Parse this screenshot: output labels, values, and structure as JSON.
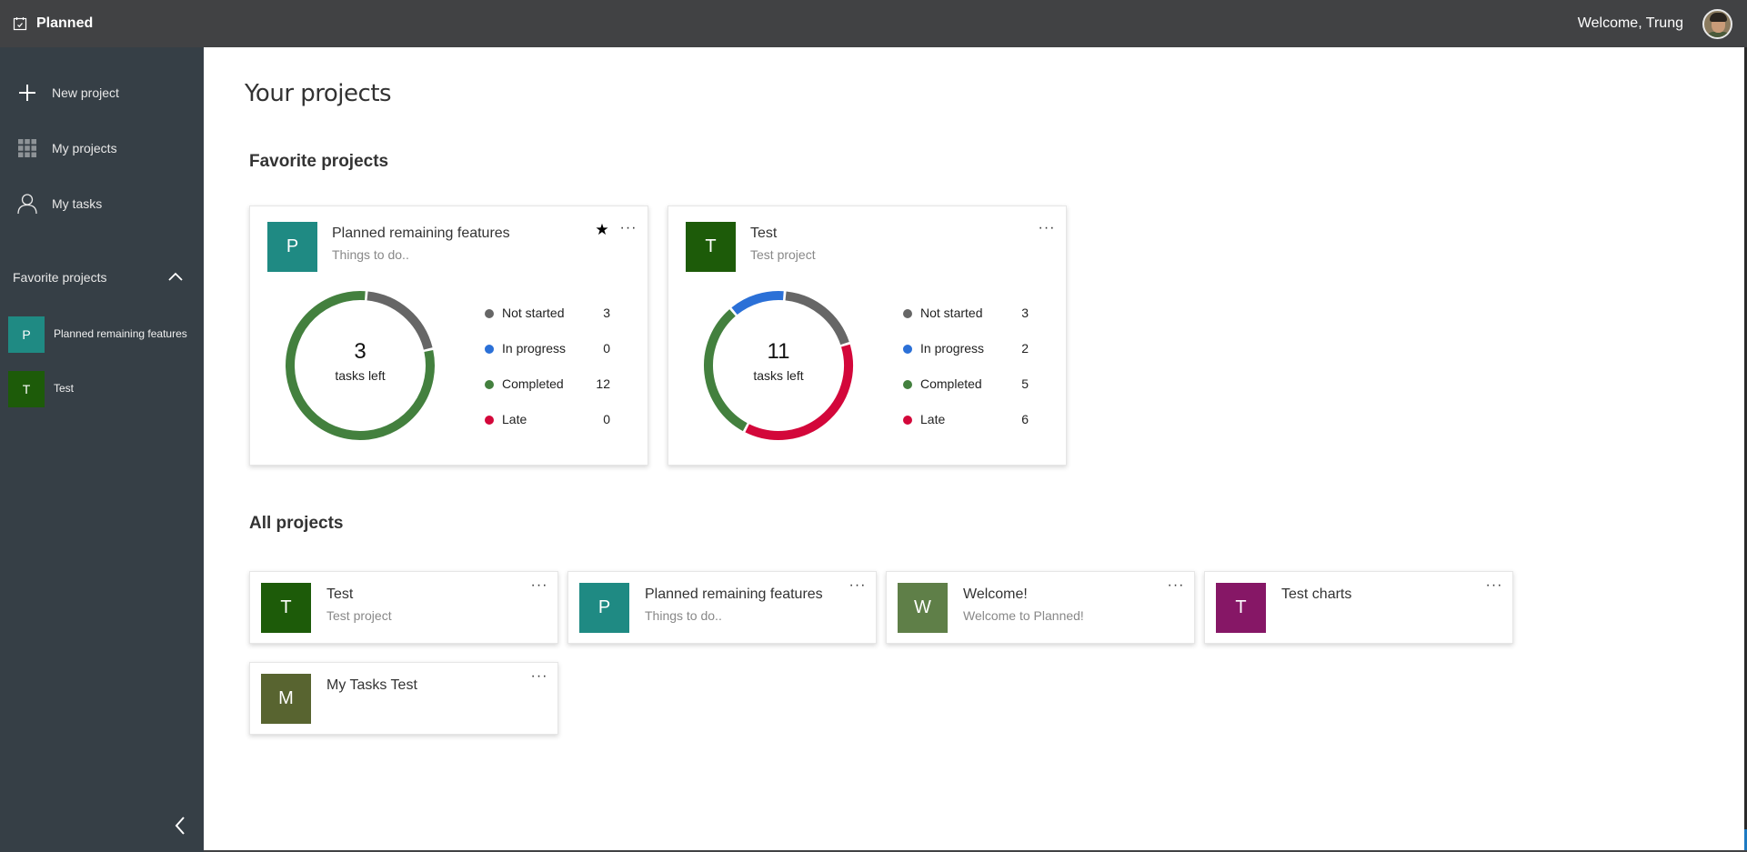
{
  "app": {
    "title": "Planned",
    "welcome": "Welcome, Trung"
  },
  "sidebar": {
    "nav": [
      {
        "label": "New project",
        "icon": "plus-icon"
      },
      {
        "label": "My projects",
        "icon": "grid-icon"
      },
      {
        "label": "My tasks",
        "icon": "person-icon"
      }
    ],
    "favorites_title": "Favorite projects",
    "favorites": [
      {
        "initial": "P",
        "label": "Planned remaining features",
        "color": "#1f8a83"
      },
      {
        "initial": "T",
        "label": "Test",
        "color": "#1d5b09"
      }
    ]
  },
  "main": {
    "page_title": "Your projects",
    "favorites_heading": "Favorite projects",
    "all_heading": "All projects",
    "status_colors": {
      "not_started": "#666666",
      "in_progress": "#2b70d7",
      "completed": "#43803e",
      "late": "#d3073a"
    },
    "favorite_cards": [
      {
        "initial": "P",
        "color": "#1f8a83",
        "title": "Planned remaining features",
        "subtitle": "Things to do..",
        "starred": true,
        "star": "★",
        "more": "···",
        "tasks_left": "3",
        "tasks_left_label": "tasks left",
        "legend": [
          {
            "key": "not_started",
            "label": "Not started",
            "value": 3
          },
          {
            "key": "in_progress",
            "label": "In progress",
            "value": 0
          },
          {
            "key": "completed",
            "label": "Completed",
            "value": 12
          },
          {
            "key": "late",
            "label": "Late",
            "value": 0
          }
        ]
      },
      {
        "initial": "T",
        "color": "#1d5b09",
        "title": "Test",
        "subtitle": "Test project",
        "starred": false,
        "star": "",
        "more": "···",
        "tasks_left": "11",
        "tasks_left_label": "tasks left",
        "legend": [
          {
            "key": "not_started",
            "label": "Not started",
            "value": 3
          },
          {
            "key": "in_progress",
            "label": "In progress",
            "value": 2
          },
          {
            "key": "completed",
            "label": "Completed",
            "value": 5
          },
          {
            "key": "late",
            "label": "Late",
            "value": 6
          }
        ]
      }
    ],
    "all_projects": [
      {
        "initial": "T",
        "color": "#1d5b09",
        "title": "Test",
        "subtitle": "Test project",
        "more": "···"
      },
      {
        "initial": "P",
        "color": "#1f8a83",
        "title": "Planned remaining features",
        "subtitle": "Things to do..",
        "more": "···"
      },
      {
        "initial": "W",
        "color": "#5f7f48",
        "title": "Welcome!",
        "subtitle": "Welcome to Planned!",
        "more": "···"
      },
      {
        "initial": "T",
        "color": "#861766",
        "title": "Test charts",
        "subtitle": "",
        "more": "···"
      },
      {
        "initial": "M",
        "color": "#586430",
        "title": "My Tasks Test",
        "subtitle": "",
        "more": "···"
      }
    ]
  }
}
